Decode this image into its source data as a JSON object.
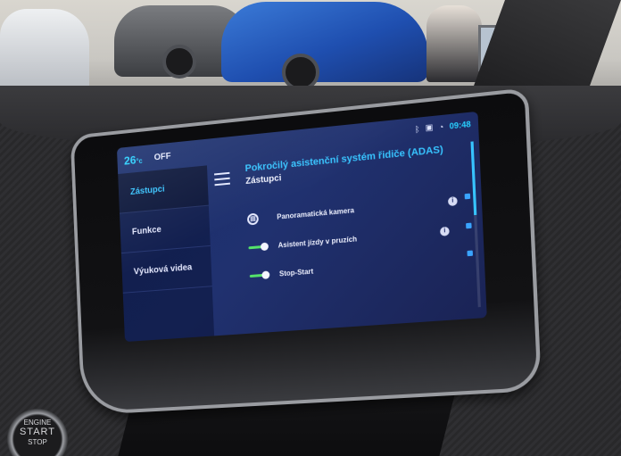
{
  "status_bar": {
    "temperature": "26",
    "temperature_unit": "°c",
    "ac_state": "OFF",
    "icons": [
      "bluetooth-icon",
      "network-icon",
      "wifi-icon"
    ],
    "clock": "09:48"
  },
  "nav": {
    "items": [
      {
        "label": "Zástupci",
        "active": true
      },
      {
        "label": "Funkce",
        "active": false
      },
      {
        "label": "Výuková videa",
        "active": false
      }
    ]
  },
  "content": {
    "title": "Pokročilý asistenční systém řidiče (ADAS)",
    "subtitle": "Zástupci",
    "rows": [
      {
        "label": "Panoramatická kamera",
        "lead": "camera-icon"
      },
      {
        "label": "Asistent jízdy v pruzích",
        "lead": "toggle-on"
      },
      {
        "label": "Stop-Start",
        "lead": "toggle-on"
      }
    ],
    "info_glyph": "i"
  },
  "start_button": {
    "line1": "ENGINE",
    "line2": "START",
    "line3": "STOP"
  },
  "colors": {
    "accent": "#37c4ff",
    "screen_bg": "#1f2f6a",
    "toggle_on": "#55e36a"
  }
}
